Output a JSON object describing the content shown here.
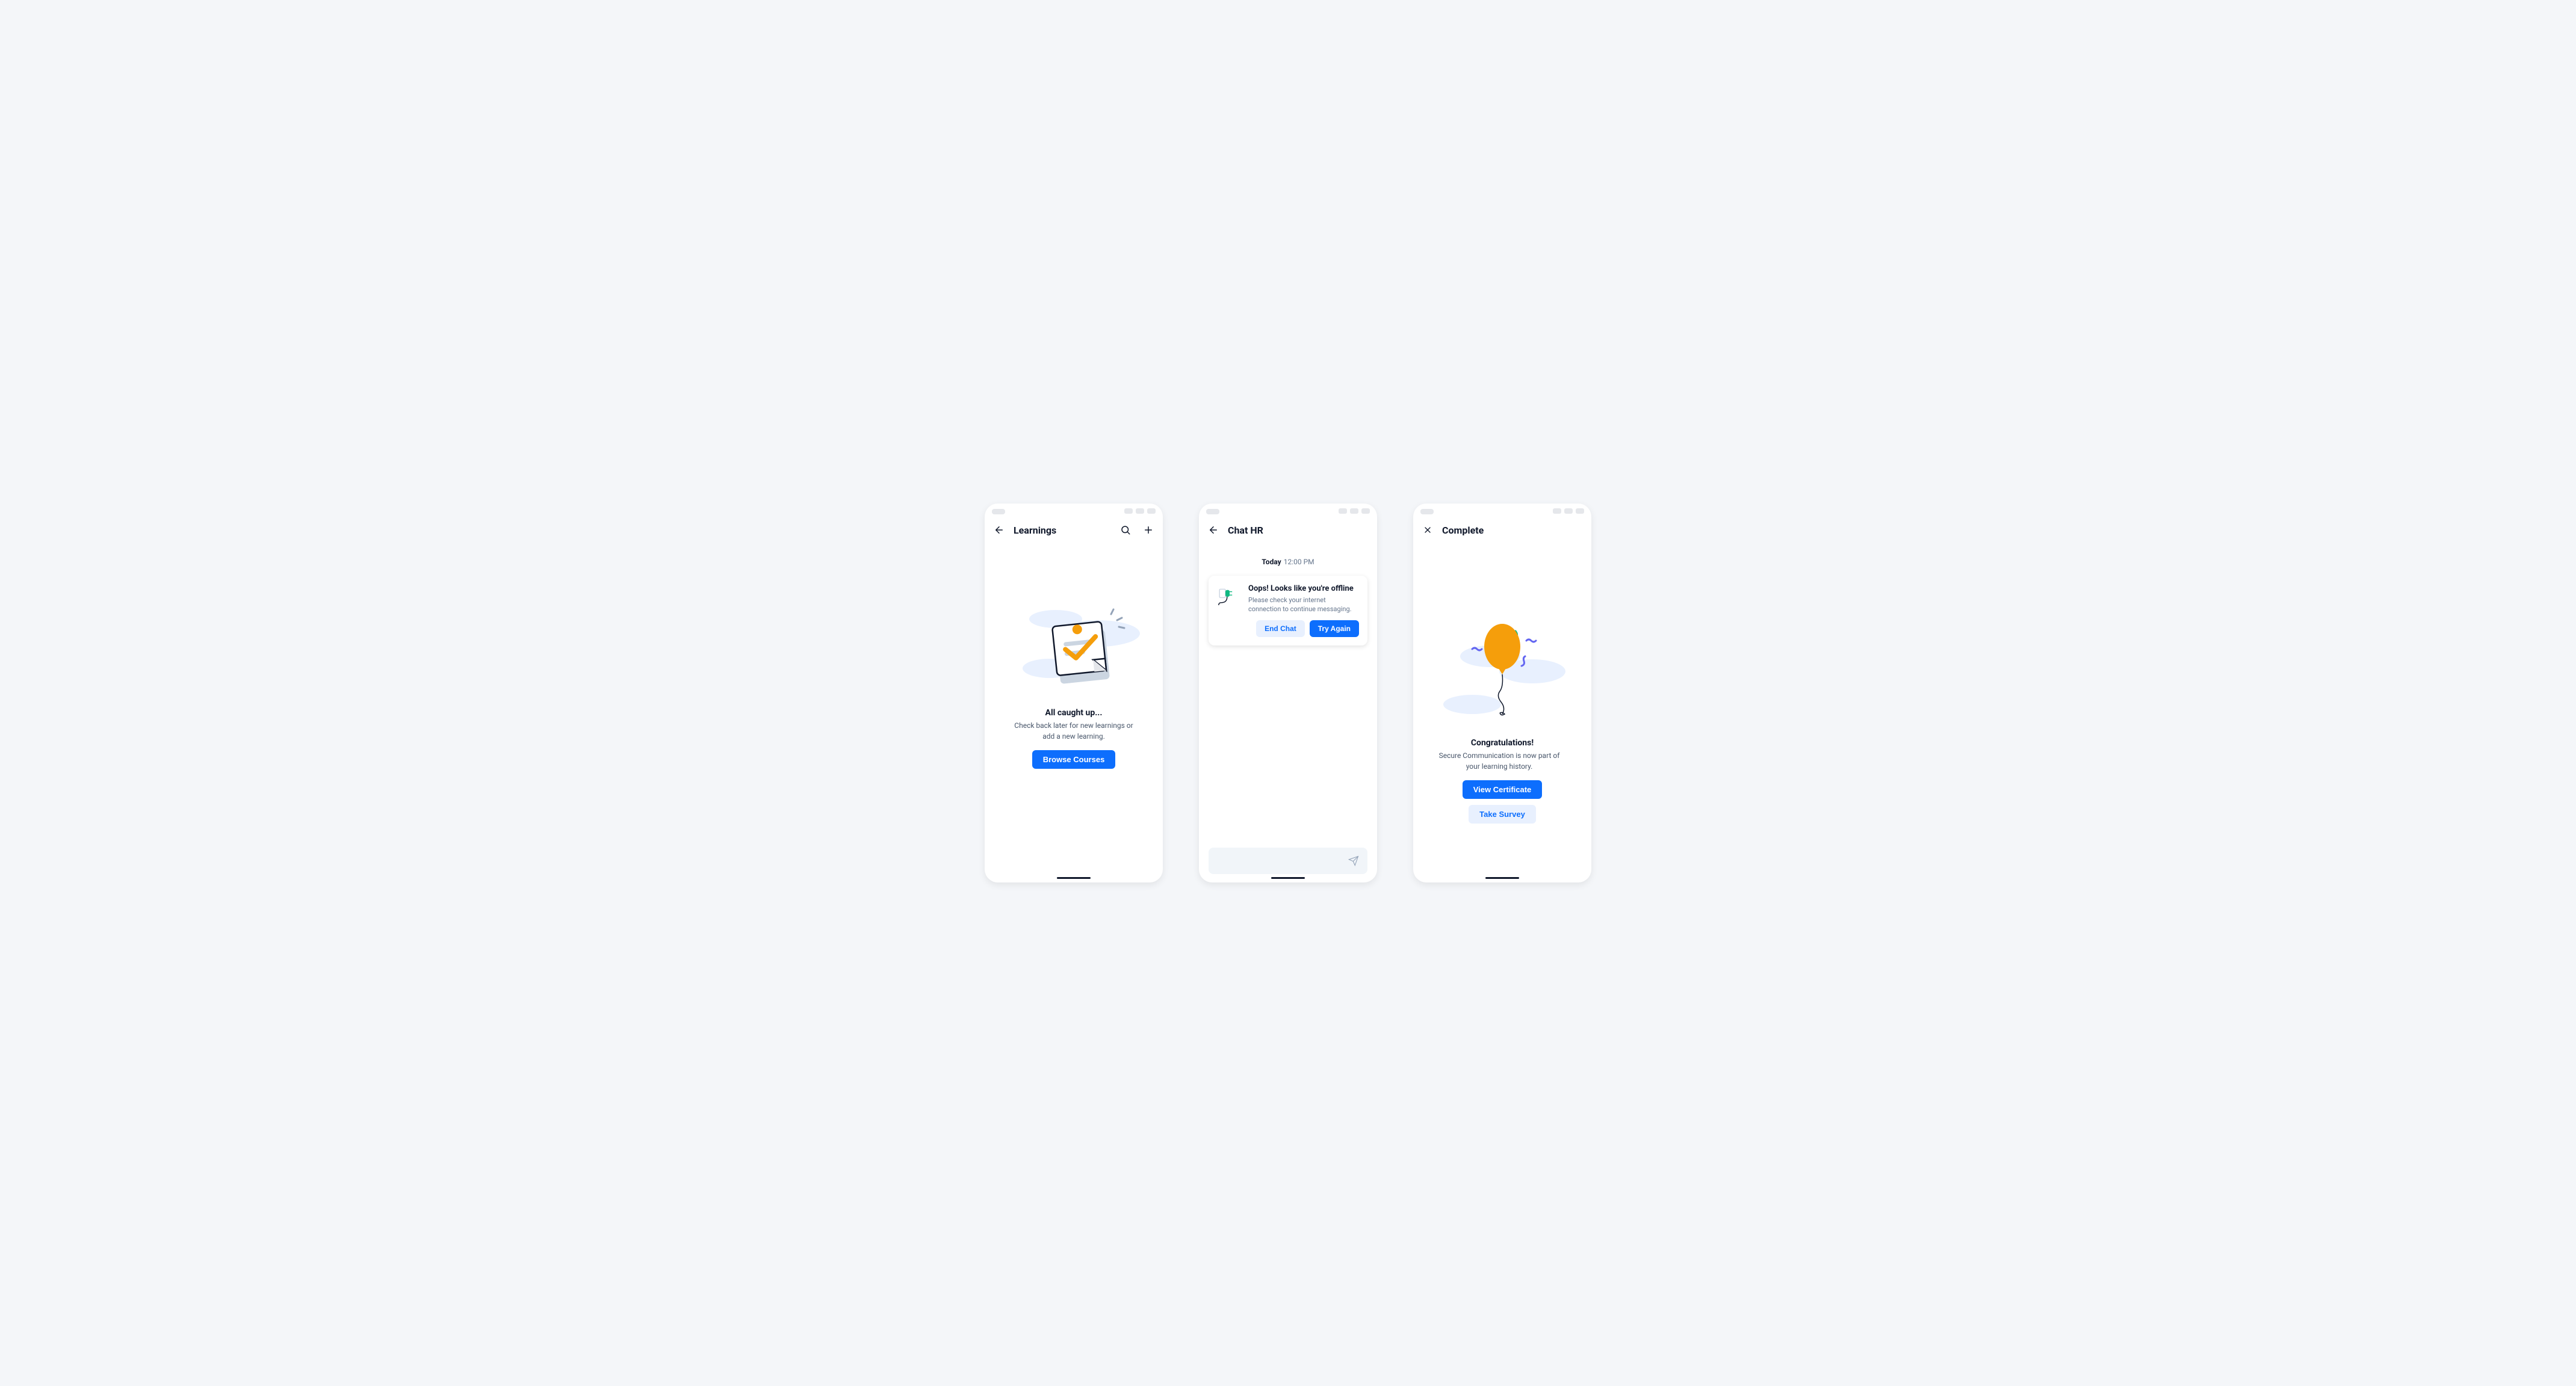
{
  "screens": {
    "learnings": {
      "title": "Learnings",
      "empty_title": "All caught up...",
      "empty_desc": "Check back later for new learnings or add a new learning.",
      "browse_btn": "Browse Courses"
    },
    "chat": {
      "title": "Chat HR",
      "day": "Today",
      "time": "12:00 PM",
      "offline_title": "Oops! Looks like you're offline",
      "offline_desc": "Please check your internet connection to continue messaging.",
      "end_chat_btn": "End Chat",
      "try_again_btn": "Try Again"
    },
    "complete": {
      "title": "Complete",
      "congrats_title": "Congratulations!",
      "congrats_desc": "Secure Communication is now part of your learning history.",
      "certificate_btn": "View Certificate",
      "survey_btn": "Take Survey"
    }
  }
}
